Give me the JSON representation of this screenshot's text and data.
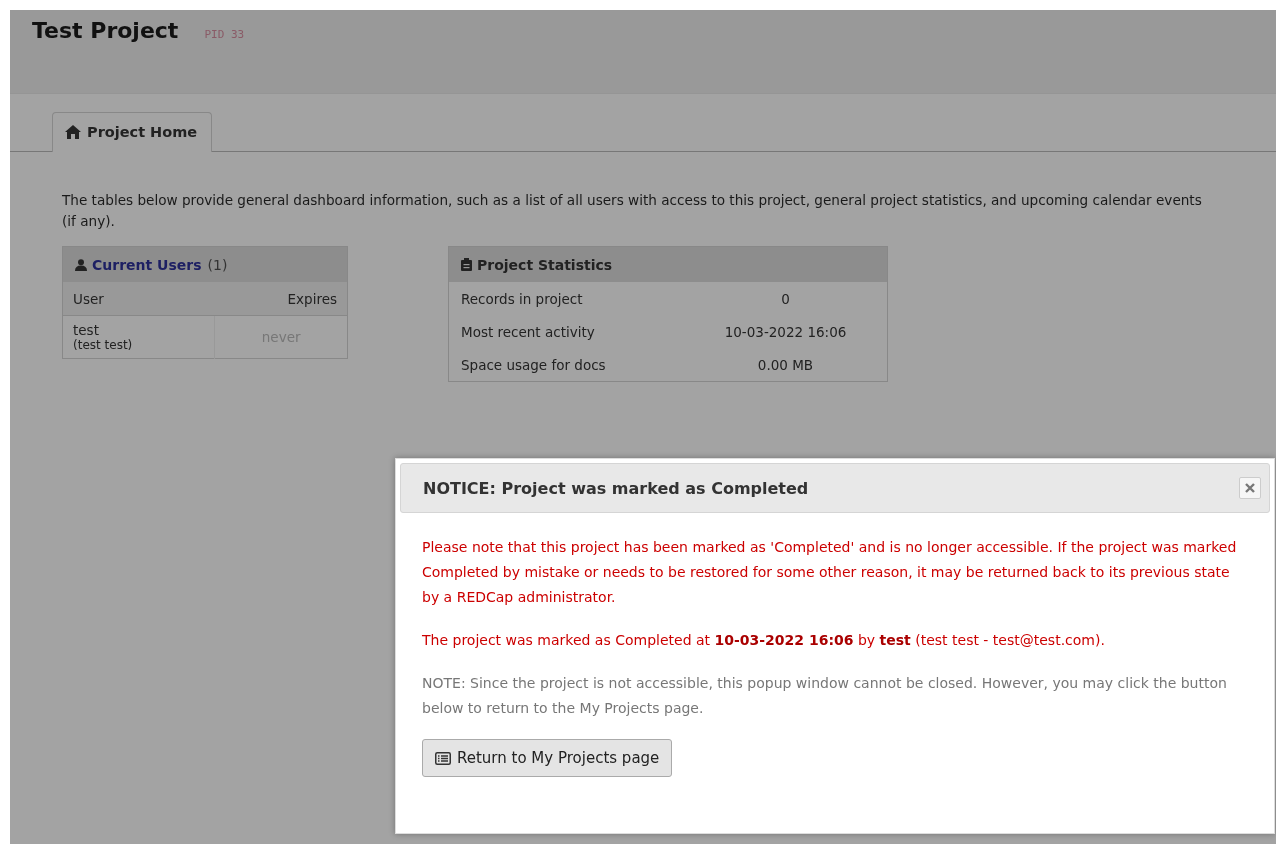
{
  "header": {
    "title": "Test Project",
    "pid": "PID 33"
  },
  "tabs": [
    {
      "label": "Project Home",
      "selected": true
    }
  ],
  "intro": "The tables below provide general dashboard information, such as a list of all users with access to this project, general project statistics, and upcoming calendar events (if any).",
  "users": {
    "title": "Current Users",
    "count": "(1)",
    "columns": [
      "User",
      "Expires"
    ],
    "rows": [
      {
        "user": "test",
        "name": "(test test)",
        "expires": "never"
      }
    ]
  },
  "stats": {
    "title": "Project Statistics",
    "rows": [
      {
        "label": "Records in project",
        "value": "0"
      },
      {
        "label": "Most recent activity",
        "value": "10-03-2022 16:06"
      },
      {
        "label": "Space usage for docs",
        "value": "0.00 MB"
      }
    ]
  },
  "dialog": {
    "title": "NOTICE: Project was marked as Completed",
    "paragraphs": [
      {
        "kind": "warning",
        "text": "Please note that this project has been marked as 'Completed' and is no longer accessible. If the project was marked Completed by mistake or needs to be restored for some other reason, it may be returned back to its previous state by a REDCap administrator."
      },
      {
        "kind": "warning",
        "text": "The project was marked as Completed at **10-03-2022 16:06** by **test** (test test - test@test.com)."
      },
      {
        "kind": "note",
        "text": "NOTE: Since the project is not accessible, this popup window cannot be closed. However, you may click the button below to return to the My Projects page."
      }
    ],
    "button": "Return to My Projects page"
  }
}
